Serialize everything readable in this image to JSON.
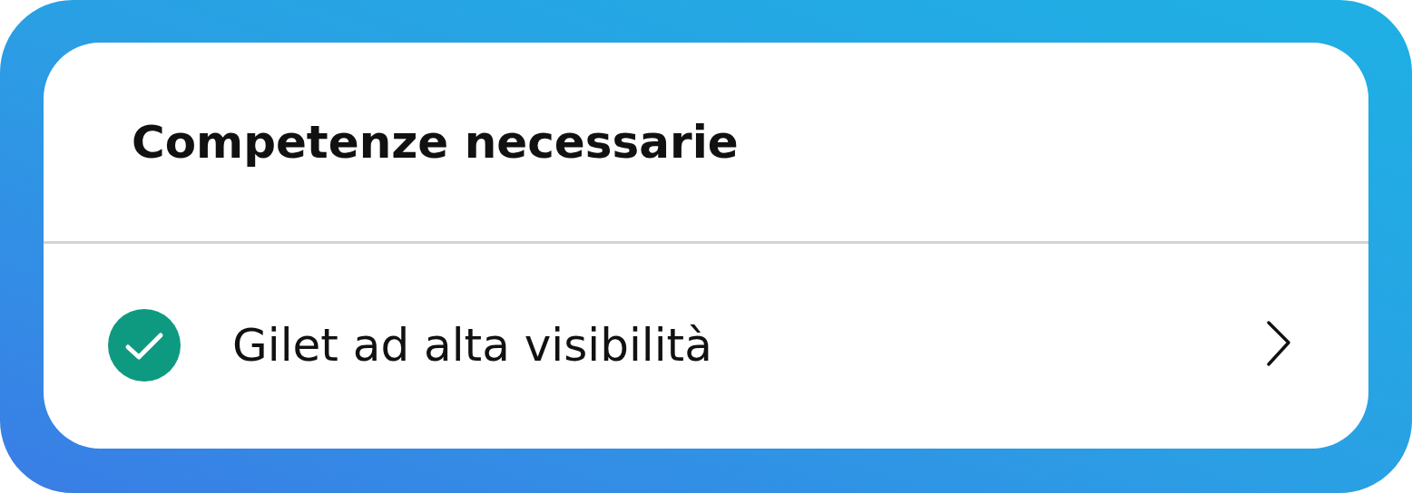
{
  "title": "Competenze necessarie",
  "items": [
    {
      "label": "Gilet ad alta visibilità",
      "checked": true
    }
  ]
}
